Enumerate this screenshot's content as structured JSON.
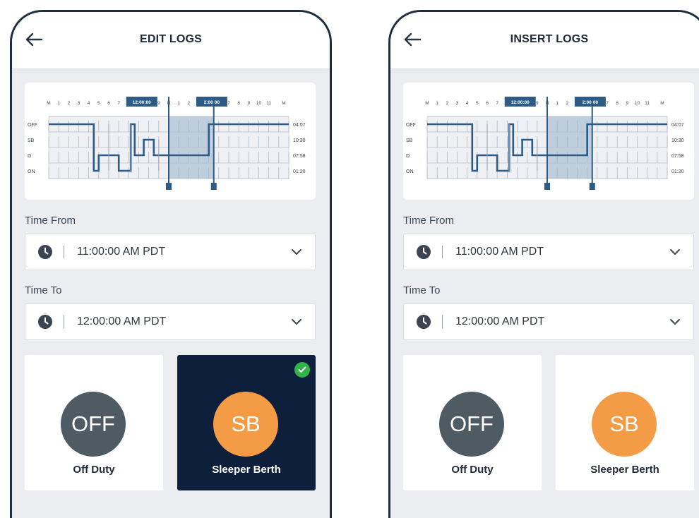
{
  "screens": [
    {
      "title": "EDIT LOGS",
      "chart": {
        "hours": [
          "M",
          "1",
          "2",
          "3",
          "4",
          "5",
          "6",
          "7",
          "12:00:00",
          "9",
          "N",
          "1",
          "2",
          "2:00:00",
          "7",
          "8",
          "9",
          "10",
          "11",
          "M"
        ],
        "rows": [
          "OFF",
          "SB",
          "D",
          "ON"
        ],
        "totals": [
          "04:07",
          "10:30",
          "07:58",
          "01:20"
        ]
      },
      "time_from": {
        "label": "Time From",
        "value": "11:00:00 AM PDT"
      },
      "time_to": {
        "label": "Time To",
        "value": "12:00:00 AM PDT"
      },
      "statuses": [
        {
          "code": "OFF",
          "name": "Off Duty",
          "selected": false
        },
        {
          "code": "SB",
          "name": "Sleeper Berth",
          "selected": true
        }
      ]
    },
    {
      "title": "INSERT LOGS",
      "chart": {
        "hours": [
          "M",
          "1",
          "2",
          "3",
          "4",
          "5",
          "6",
          "7",
          "12:00:00",
          "9",
          "N",
          "1",
          "2",
          "2:00:00",
          "7",
          "8",
          "9",
          "10",
          "11",
          "M"
        ],
        "rows": [
          "OFF",
          "SB",
          "D",
          "ON"
        ],
        "totals": [
          "04:07",
          "10:30",
          "07:58",
          "01:20"
        ]
      },
      "time_from": {
        "label": "Time From",
        "value": "11:00:00 AM PDT"
      },
      "time_to": {
        "label": "Time To",
        "value": "12:00:00 AM PDT"
      },
      "statuses": [
        {
          "code": "OFF",
          "name": "Off Duty",
          "selected": false
        },
        {
          "code": "SB",
          "name": "Sleeper Berth",
          "selected": false
        }
      ]
    }
  ],
  "colors": {
    "accent": "#2d5b86",
    "highlight": "#a9bfd3",
    "off_circle": "#4f5b63",
    "sb_circle": "#f39c45",
    "selected_card": "#0d1f3a",
    "check": "#33b249"
  },
  "icons": {
    "back": "arrow-left-icon",
    "clock": "clock-icon",
    "dropdown": "chevron-down-icon",
    "check": "check-circle-icon"
  }
}
